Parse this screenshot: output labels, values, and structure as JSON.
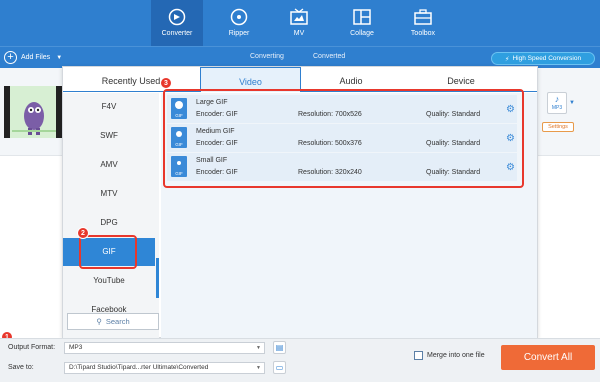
{
  "nav": {
    "items": [
      {
        "label": "Converter",
        "icon": "converter-icon"
      },
      {
        "label": "Ripper",
        "icon": "disc-icon"
      },
      {
        "label": "MV",
        "icon": "tv-icon"
      },
      {
        "label": "Collage",
        "icon": "collage-icon"
      },
      {
        "label": "Toolbox",
        "icon": "toolbox-icon"
      }
    ],
    "active": "Converter"
  },
  "subbar": {
    "add_files": "Add Files",
    "tab_converting": "Converting",
    "tab_converted": "Converted",
    "high_speed": "High Speed Conversion"
  },
  "file_row": {
    "format_badge": "MP3",
    "settings_label": "Settings"
  },
  "popup": {
    "tabs": [
      "Recently Used",
      "Video",
      "Audio",
      "Device"
    ],
    "active_tab": "Video",
    "formats": [
      "F4V",
      "SWF",
      "AMV",
      "MTV",
      "DPG",
      "GIF",
      "YouTube",
      "Facebook"
    ],
    "active_format": "GIF",
    "search_label": "Search",
    "presets": [
      {
        "name": "Large GIF",
        "encoder": "Encoder: GIF",
        "resolution": "Resolution: 700x526",
        "quality": "Quality: Standard"
      },
      {
        "name": "Medium GIF",
        "encoder": "Encoder: GIF",
        "resolution": "Resolution: 500x376",
        "quality": "Quality: Standard"
      },
      {
        "name": "Small GIF",
        "encoder": "Encoder: GIF",
        "resolution": "Resolution: 320x240",
        "quality": "Quality: Standard"
      }
    ],
    "preset_icon_text": "GIF"
  },
  "annotations": [
    "1",
    "2",
    "3"
  ],
  "bottom": {
    "output_format_label": "Output Format:",
    "output_format_value": "MP3",
    "save_to_label": "Save to:",
    "save_to_value": "D:\\Tipard Studio\\Tipard...rter Ultimate\\Converted",
    "merge_label": "Merge into one file",
    "convert_all": "Convert All"
  },
  "colors": {
    "brand_blue": "#2f7fcf",
    "annotation_red": "#e8372c",
    "convert_orange": "#ef6a37"
  }
}
